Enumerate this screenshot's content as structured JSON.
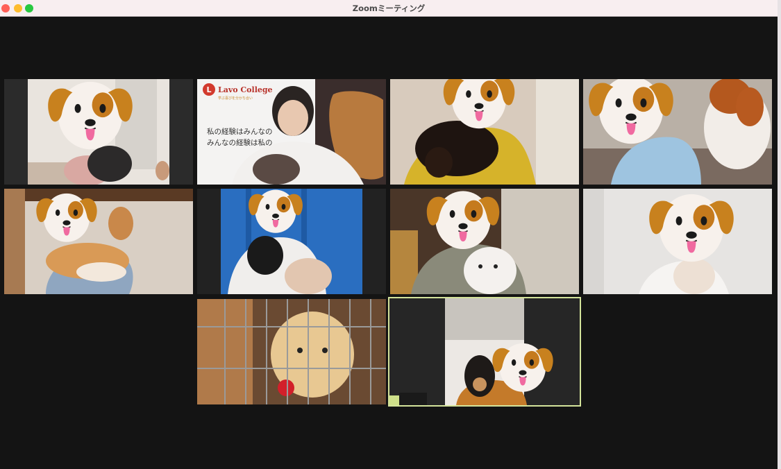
{
  "window": {
    "title": "Zoomミーティング"
  },
  "slide": {
    "logo_mark": "L",
    "logo_text": "Lavo College",
    "logo_sub": "学ぶ喜びを分かち合い",
    "line1": "私の経験はみんなの",
    "line2": "みんなの経験は私の"
  },
  "participants": [
    {
      "id": "p1",
      "emoji": "dog-face",
      "dog": "black-shaggy"
    },
    {
      "id": "p2",
      "emoji": "none",
      "dog": "shih-tzu",
      "content": "presentation-slide"
    },
    {
      "id": "p3",
      "emoji": "dog-face",
      "dog": "dachshund"
    },
    {
      "id": "p4",
      "emoji": "dog-face",
      "dog": "papillon"
    },
    {
      "id": "p5",
      "emoji": "dog-face",
      "dog": "corgi"
    },
    {
      "id": "p6",
      "emoji": "dog-face",
      "dog": "shiba-black"
    },
    {
      "id": "p7",
      "emoji": "dog-face",
      "dog": "bichon"
    },
    {
      "id": "p8",
      "emoji": "dog-face",
      "dog": "maltese"
    },
    {
      "id": "p9",
      "emoji": "none",
      "dog": "labrador-in-crate"
    },
    {
      "id": "p10",
      "emoji": "dog-face",
      "dog": "shiba-black",
      "active_speaker": true
    }
  ],
  "colors": {
    "active_border": "#d4e49b",
    "background": "#141414"
  }
}
